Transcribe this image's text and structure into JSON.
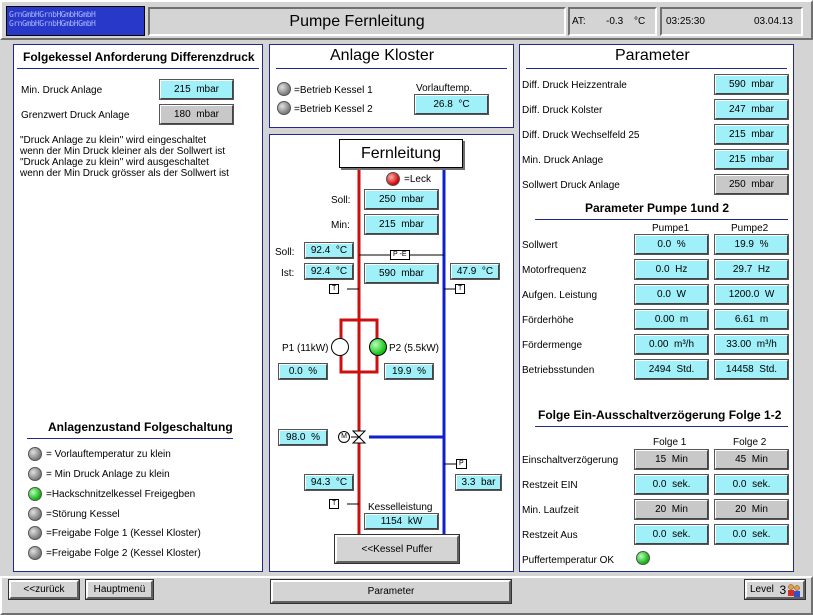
{
  "header": {
    "logo_text": "GrnGmbHGrnbHGmbHGmbH",
    "title": "Pumpe Fernleitung",
    "at_label": "AT:",
    "at_value": "-0.3",
    "at_unit": "°C",
    "time": "03:25:30",
    "date": "03.04.13"
  },
  "left_panel": {
    "title": "Folgekessel Anforderung Differenzdruck",
    "min_druck_label": "Min. Druck Anlage",
    "min_druck_value": "215",
    "min_druck_unit": "mbar",
    "grenzwert_label": "Grenzwert Druck Anlage",
    "grenzwert_value": "180",
    "grenzwert_unit": "mbar",
    "note_lines": [
      "\"Druck Anlage zu klein\" wird eingeschaltet",
      "wenn der Min Druck kleiner als der Sollwert ist",
      "\"Druck Anlage zu klein\" wird ausgeschaltet",
      "wenn der Min Druck grösser als der Sollwert ist"
    ],
    "status_title": "Anlagenzustand Folgeschaltung",
    "status_items": [
      {
        "label": "= Vorlauftemperatur zu klein",
        "state": "gray"
      },
      {
        "label": "= Min Druck Anlage zu klein",
        "state": "gray"
      },
      {
        "label": "=Hackschnitzelkessel Freigegben",
        "state": "green"
      },
      {
        "label": "=Störung Kessel",
        "state": "gray"
      },
      {
        "label": "=Freigabe Folge 1 (Kessel Kloster)",
        "state": "gray"
      },
      {
        "label": "=Freigabe Folge 2 (Kessel Kloster)",
        "state": "gray"
      }
    ]
  },
  "anlage": {
    "title": "Anlage Kloster",
    "kessel1": "=Betrieb Kessel 1",
    "kessel2": "=Betrieb Kessel 2",
    "vorlauf_label": "Vorlauftemp.",
    "vorlauf_value": "26.8",
    "vorlauf_unit": "°C"
  },
  "fernleitung": {
    "title": "Fernleitung",
    "leck_label": "=Leck",
    "soll_label": "Soll:",
    "soll_druck": "250",
    "min_label": "Min:",
    "min_druck": "215",
    "druck_unit": "mbar",
    "soll_temp_label": "Soll:",
    "soll_temp": "92.4",
    "ist_label": "Ist:",
    "ist_temp": "92.4",
    "temp_unit": "°C",
    "diff_druck": "590",
    "ruecklauf_temp": "47.9",
    "p1_label": "P1 (11kW)",
    "p2_label": "P2 (5.5kW)",
    "p1_value": "0.0",
    "p2_value": "19.9",
    "pct_unit": "%",
    "valve_value": "98.0",
    "kessel_temp": "94.3",
    "druck_bar": "3.3",
    "bar_unit": "bar",
    "kesselleistung_label": "Kesselleistung",
    "kesselleistung_value": "1154",
    "kw_unit": "kW",
    "puffer_button": "<<Kessel Puffer",
    "tag_t": "T",
    "tag_p": "P",
    "tag_pe": "P -E",
    "valve_m": "M"
  },
  "parameter": {
    "title": "Parameter",
    "rows": [
      {
        "label": "Diff. Druck Heizzentrale",
        "value": "590",
        "unit": "mbar",
        "style": "cy"
      },
      {
        "label": "Diff. Druck Kolster",
        "value": "247",
        "unit": "mbar",
        "style": "cy"
      },
      {
        "label": "Diff. Druck Wechselfeld 25",
        "value": "215",
        "unit": "mbar",
        "style": "cy"
      },
      {
        "label": "Min. Druck Anlage",
        "value": "215",
        "unit": "mbar",
        "style": "cy"
      },
      {
        "label": "Sollwert Druck Anlage",
        "value": "250",
        "unit": "mbar",
        "style": "gy"
      }
    ],
    "pumps_title": "Parameter Pumpe 1und 2",
    "pump1_header": "Pumpe1",
    "pump2_header": "Pumpe2",
    "pump_rows": [
      {
        "label": "Sollwert",
        "p1": "0.0",
        "p2": "19.9",
        "unit": "%"
      },
      {
        "label": "Motorfrequenz",
        "p1": "0.0",
        "p2": "29.7",
        "unit": "Hz"
      },
      {
        "label": "Aufgen. Leistung",
        "p1": "0.0",
        "p2": "1200.0",
        "unit": "W"
      },
      {
        "label": "Förderhöhe",
        "p1": "0.00",
        "p2": "6.61",
        "unit": "m"
      },
      {
        "label": "Fördermenge",
        "p1": "0.00",
        "p2": "33.00",
        "unit": "m³/h"
      },
      {
        "label": "Betriebsstunden",
        "p1": "2494",
        "p2": "14458",
        "unit": "Std."
      }
    ],
    "folge_title": "Folge Ein-Ausschaltverzögerung Folge 1-2",
    "folge1_header": "Folge 1",
    "folge2_header": "Folge 2",
    "folge_rows": [
      {
        "label": "Einschaltverzögerung",
        "f1": "15",
        "f2": "45",
        "unit": "Min",
        "style": "gy"
      },
      {
        "label": "Restzeit EIN",
        "f1": "0.0",
        "f2": "0.0",
        "unit": "sek.",
        "style": "cy"
      },
      {
        "label": "Min. Laufzeit",
        "f1": "20",
        "f2": "20",
        "unit": "Min",
        "style": "gy"
      },
      {
        "label": "Restzeit Aus",
        "f1": "0.0",
        "f2": "0.0",
        "unit": "sek.",
        "style": "cy"
      }
    ],
    "puffer_ok_label": "Puffertemperatur OK"
  },
  "footer": {
    "back_button": "<<zurück",
    "menu_button": "Hauptmenü",
    "parameter_button": "Parameter",
    "level_label": "Level",
    "level_value": "3"
  },
  "colors": {
    "panel_border": "#1e2a8a",
    "value_cyan": "#9ff0f8",
    "value_gray": "#c8c8c8",
    "pipe_red": "#cc1010",
    "pipe_blue": "#1020cc",
    "lamp_green": "#10b010"
  }
}
